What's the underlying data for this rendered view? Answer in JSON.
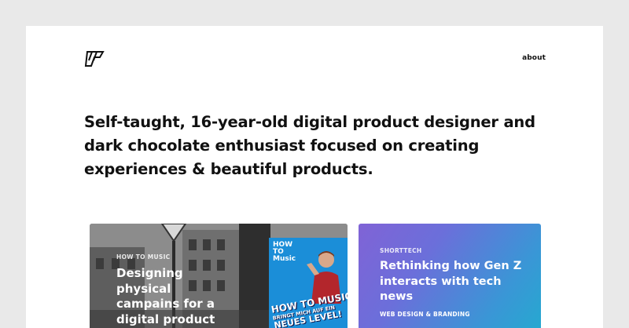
{
  "header": {
    "logo_icon": "monogram-logo-icon",
    "nav": {
      "about_label": "about"
    }
  },
  "hero": {
    "headline": "Self-taught, 16-year-old digital product designer and dark chocolate enthusiast focused on creating experiences & beautiful products."
  },
  "projects": [
    {
      "category": "HOW TO MUSIC",
      "title": "Designing physical campains for a digital product",
      "image": {
        "poster_small_text": "HOW TO Music",
        "poster_headline": "HOW TO MUSIC",
        "poster_subline": "BRINGT MICH AUF EIN",
        "poster_bottom": "NEUES LEVEL!"
      }
    },
    {
      "category": "SHORTTECH",
      "title": "Rethinking how Gen Z interacts with tech news",
      "tag": "WEB DESIGN & BRANDING",
      "gradient": [
        "#8063d6",
        "#25a9d0"
      ]
    }
  ]
}
